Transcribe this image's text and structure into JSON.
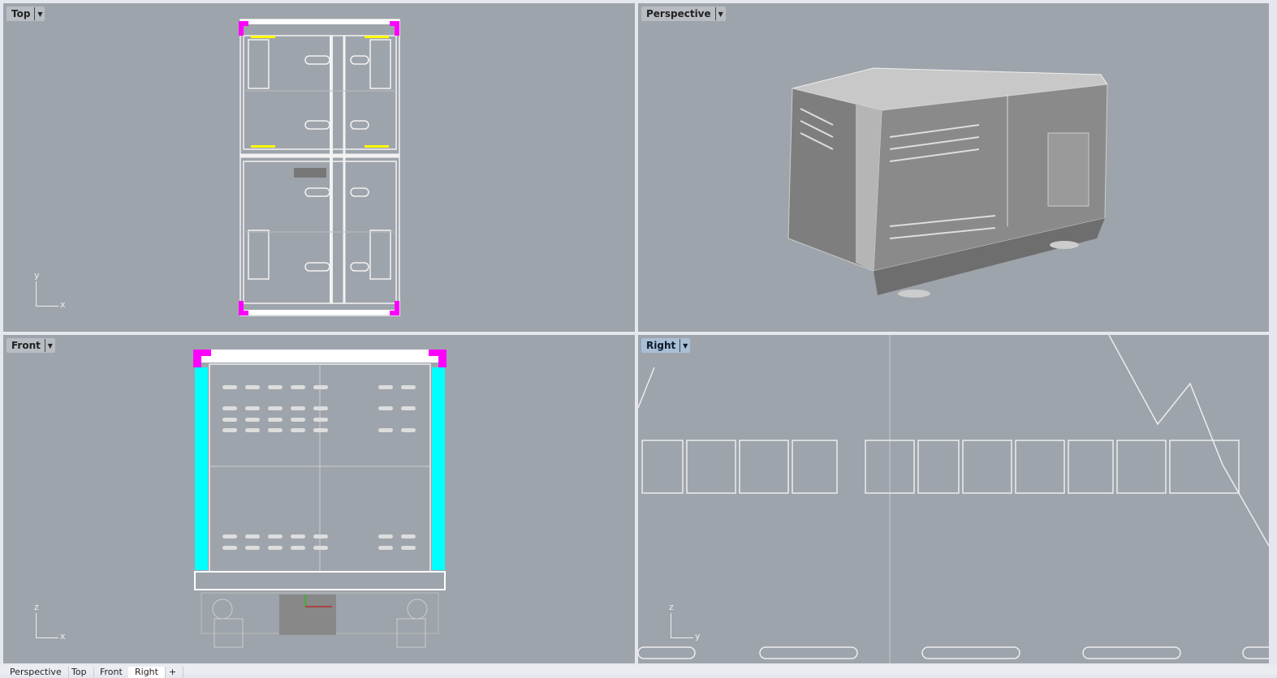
{
  "viewports": {
    "top": {
      "label": "Top",
      "axis_v": "y",
      "axis_h": "x"
    },
    "perspective": {
      "label": "Perspective"
    },
    "front": {
      "label": "Front",
      "axis_v": "z",
      "axis_h": "x"
    },
    "right": {
      "label": "Right",
      "axis_v": "z",
      "axis_h": "y",
      "active": true
    }
  },
  "tabs": [
    {
      "label": "Perspective"
    },
    {
      "label": "Top"
    },
    {
      "label": "Front"
    },
    {
      "label": "Right",
      "active": true
    }
  ],
  "add_tab_label": "+",
  "colors": {
    "viewport_bg": "#9ea4ab",
    "active_label": "#a9bfd6",
    "magenta": "#ff00ff",
    "cyan": "#00ffff",
    "yellow": "#ffff00"
  }
}
